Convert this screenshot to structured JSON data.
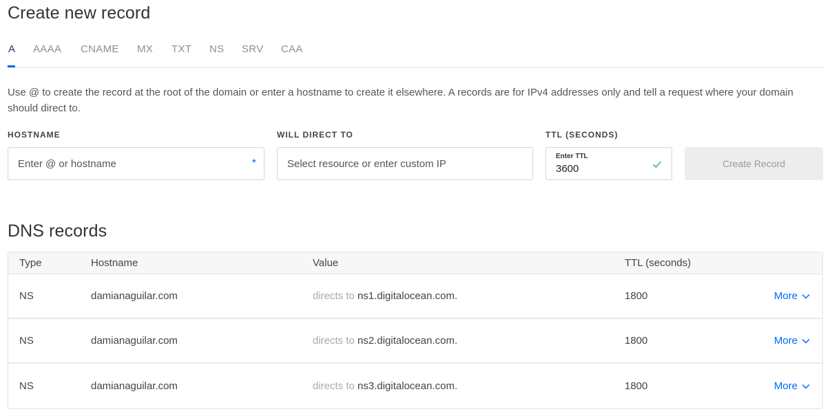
{
  "create": {
    "title": "Create new record",
    "tabs": [
      "A",
      "AAAA",
      "CNAME",
      "MX",
      "TXT",
      "NS",
      "SRV",
      "CAA"
    ],
    "active_tab": "A",
    "description": "Use @ to create the record at the root of the domain or enter a hostname to create it elsewhere. A records are for IPv4 addresses only and tell a request where your domain should direct to.",
    "hostname": {
      "label": "HOSTNAME",
      "placeholder": "Enter @ or hostname",
      "required_mark": "*"
    },
    "direct": {
      "label": "WILL DIRECT TO",
      "placeholder": "Select resource or enter custom IP"
    },
    "ttl": {
      "label": "TTL (SECONDS)",
      "inner_label": "Enter TTL",
      "value": "3600"
    },
    "button_label": "Create Record"
  },
  "dns": {
    "title": "DNS records",
    "columns": [
      "Type",
      "Hostname",
      "Value",
      "TTL (seconds)"
    ],
    "direct_prefix": "directs to",
    "more_label": "More",
    "rows": [
      {
        "type": "NS",
        "hostname": "damianaguilar.com",
        "value": "ns1.digitalocean.com.",
        "ttl": "1800"
      },
      {
        "type": "NS",
        "hostname": "damianaguilar.com",
        "value": "ns2.digitalocean.com.",
        "ttl": "1800"
      },
      {
        "type": "NS",
        "hostname": "damianaguilar.com",
        "value": "ns3.digitalocean.com.",
        "ttl": "1800"
      }
    ]
  },
  "colors": {
    "accent": "#0069ff",
    "check": "#2ebd6f",
    "active_tab": "#1a3b66"
  },
  "icons": {
    "required": "asterisk",
    "ttl_valid": "check-icon",
    "more": "chevron-down-icon"
  }
}
